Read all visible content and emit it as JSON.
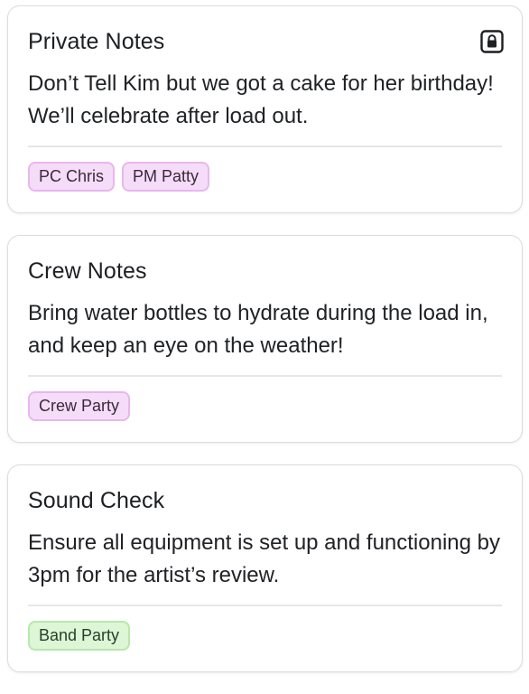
{
  "notes": [
    {
      "title": "Private Notes",
      "private": true,
      "icon": "lock-icon",
      "body": "Don’t Tell Kim but we got a cake for her birthday! We’ll celebrate after load out.",
      "tags": [
        {
          "label": "PC Chris",
          "color": "purple"
        },
        {
          "label": "PM Patty",
          "color": "purple"
        }
      ]
    },
    {
      "title": "Crew Notes",
      "private": false,
      "body": "Bring water bottles to hydrate during the load in, and keep an eye on the weather!",
      "tags": [
        {
          "label": "Crew Party",
          "color": "purple"
        }
      ]
    },
    {
      "title": "Sound Check",
      "private": false,
      "body": "Ensure all equipment is set up and functioning by 3pm for the artist’s review.",
      "tags": [
        {
          "label": "Band Party",
          "color": "green"
        }
      ]
    }
  ],
  "colors": {
    "purple_tag_bg": "#f5dcf8",
    "purple_tag_border": "#e8b7ee",
    "green_tag_bg": "#dcf6d6",
    "green_tag_border": "#b7e8ad"
  }
}
